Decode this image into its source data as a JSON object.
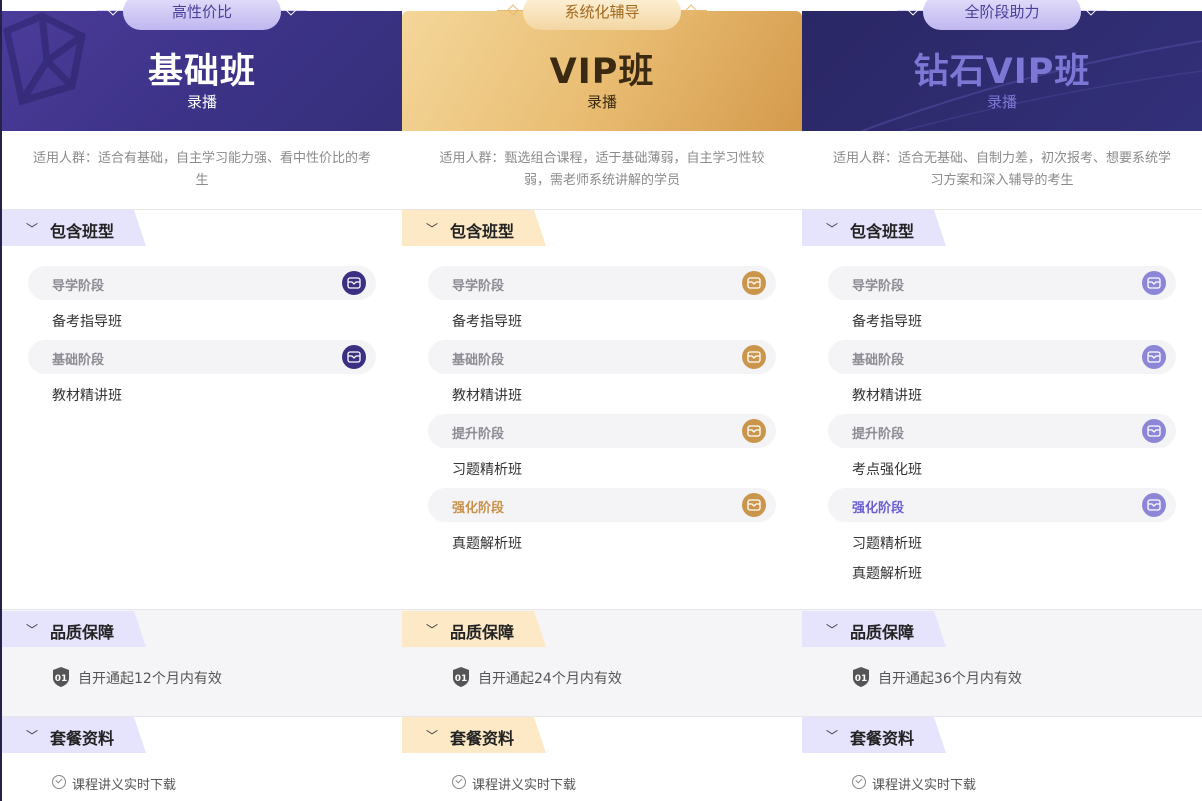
{
  "plans": [
    {
      "tag": "高性价比",
      "title": "基础班",
      "subtitle": "录播",
      "audience": "适用人群：适合有基础，自主学习能力强、看中性价比的考生",
      "sections": {
        "include": "包含班型",
        "quality": "品质保障",
        "materials": "套餐资料"
      },
      "stages": [
        {
          "label": "导学阶段",
          "courses": [
            "备考指导班"
          ]
        },
        {
          "label": "基础阶段",
          "courses": [
            "教材精讲班"
          ]
        }
      ],
      "quality_text": "自开通起12个月内有效",
      "quality_badge": "01",
      "material": "课程讲义实时下载"
    },
    {
      "tag": "系统化辅导",
      "title": "VIP班",
      "subtitle": "录播",
      "audience": "适用人群：甄选组合课程，适于基础薄弱，自主学习性较弱，需老师系统讲解的学员",
      "sections": {
        "include": "包含班型",
        "quality": "品质保障",
        "materials": "套餐资料"
      },
      "stages": [
        {
          "label": "导学阶段",
          "courses": [
            "备考指导班"
          ]
        },
        {
          "label": "基础阶段",
          "courses": [
            "教材精讲班"
          ]
        },
        {
          "label": "提升阶段",
          "courses": [
            "习题精析班"
          ]
        },
        {
          "label": "强化阶段",
          "courses": [
            "真题解析班"
          ]
        }
      ],
      "quality_text": "自开通起24个月内有效",
      "quality_badge": "01",
      "material": "课程讲义实时下载"
    },
    {
      "tag": "全阶段助力",
      "title": "钻石VIP班",
      "subtitle": "录播",
      "audience": "适用人群：适合无基础、自制力差，初次报考、想要系统学习方案和深入辅导的考生",
      "sections": {
        "include": "包含班型",
        "quality": "品质保障",
        "materials": "套餐资料"
      },
      "stages": [
        {
          "label": "导学阶段",
          "courses": [
            "备考指导班"
          ]
        },
        {
          "label": "基础阶段",
          "courses": [
            "教材精讲班"
          ]
        },
        {
          "label": "提升阶段",
          "courses": [
            "考点强化班"
          ]
        },
        {
          "label": "强化阶段",
          "courses": [
            "习题精析班",
            "真题解析班"
          ]
        }
      ],
      "quality_text": "自开通起36个月内有效",
      "quality_badge": "01",
      "material": "课程讲义实时下载"
    }
  ],
  "icons": {
    "stage": "book-icon",
    "expand": "chevron-down-icon",
    "badge": "shield-icon",
    "material": "check-circle-icon"
  },
  "colors": {
    "basic_accent": "#3a2f80",
    "vip_accent": "#c9964c",
    "diamond_accent": "#8d86d6"
  }
}
